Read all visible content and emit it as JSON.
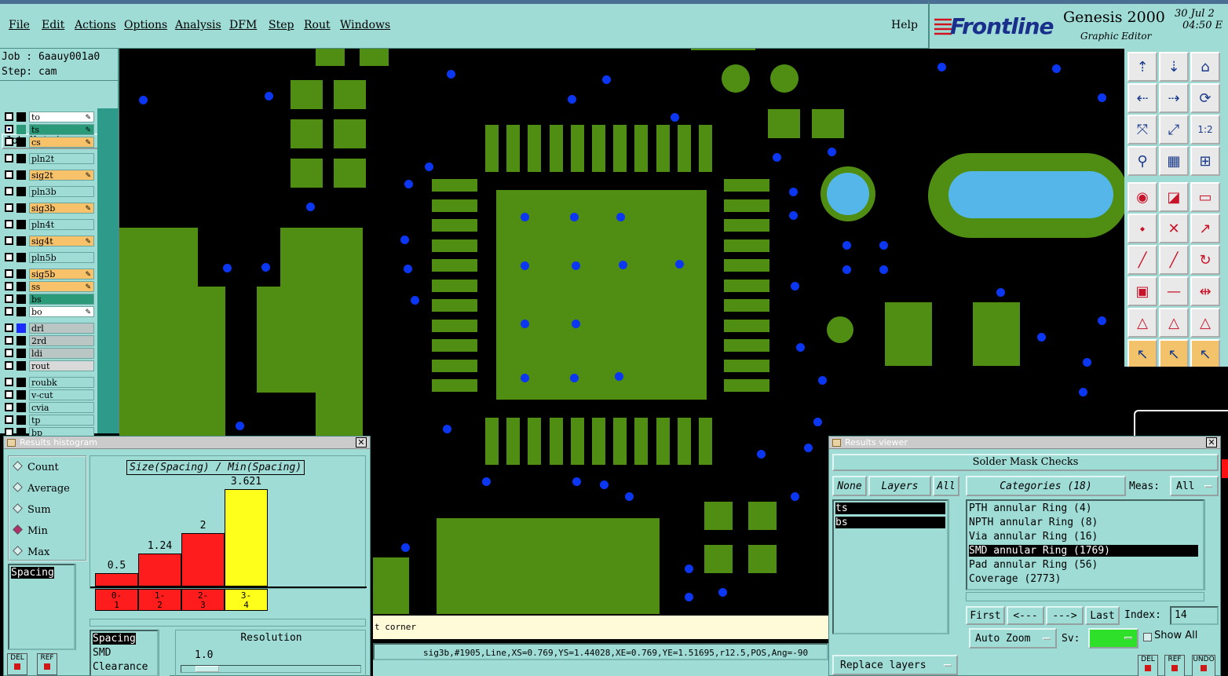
{
  "menu": {
    "items": [
      "File",
      "Edit",
      "Actions",
      "Options",
      "Analysis",
      "DFM",
      "Step",
      "Rout",
      "Windows"
    ],
    "help": "Help"
  },
  "brand": {
    "logo": "Frontline",
    "product": "Genesis 2000",
    "subtitle": "Graphic Editor",
    "date": "30 Jul 2",
    "time": "04:50 E"
  },
  "job": {
    "job_label": "Job : 6aauy001a0",
    "step_label": "Step: cam",
    "matrix_button": "Job Matrix ..."
  },
  "layers": [
    {
      "name": "to",
      "bg": "#ffffff",
      "sq": "#000000",
      "pen": true,
      "checked": false
    },
    {
      "name": "ts",
      "bg": "#2b9a78",
      "sq": "#2b9a78",
      "pen": true,
      "checked": true
    },
    {
      "name": "cs",
      "bg": "#f7c26a",
      "sq": "#000000",
      "pen": true,
      "checked": false
    },
    {
      "name": "pln2t",
      "bg": "#9fdcd6",
      "sq": "#000000",
      "pen": false,
      "checked": false
    },
    {
      "name": "sig2t",
      "bg": "#f7c26a",
      "sq": "#000000",
      "pen": true,
      "checked": false
    },
    {
      "name": "pln3b",
      "bg": "#9fdcd6",
      "sq": "#000000",
      "pen": false,
      "checked": false
    },
    {
      "name": "sig3b",
      "bg": "#f7c26a",
      "sq": "#000000",
      "pen": true,
      "checked": false
    },
    {
      "name": "pln4t",
      "bg": "#9fdcd6",
      "sq": "#000000",
      "pen": false,
      "checked": false
    },
    {
      "name": "sig4t",
      "bg": "#f7c26a",
      "sq": "#000000",
      "pen": true,
      "checked": false
    },
    {
      "name": "pln5b",
      "bg": "#9fdcd6",
      "sq": "#000000",
      "pen": false,
      "checked": false
    },
    {
      "name": "sig5b",
      "bg": "#f7c26a",
      "sq": "#000000",
      "pen": true,
      "checked": false
    },
    {
      "name": "ss",
      "bg": "#f7c26a",
      "sq": "#000000",
      "pen": true,
      "checked": false
    },
    {
      "name": "bs",
      "bg": "#2b9a78",
      "sq": "#000000",
      "pen": false,
      "checked": false
    },
    {
      "name": "bo",
      "bg": "#ffffff",
      "sq": "#000000",
      "pen": true,
      "checked": false
    },
    {
      "name": "drl",
      "bg": "#b9c6c4",
      "sq": "#1b2cff",
      "pen": false,
      "checked": false
    },
    {
      "name": "2rd",
      "bg": "#b9c6c4",
      "sq": "#000000",
      "pen": false,
      "checked": false
    },
    {
      "name": "ldi",
      "bg": "#b9c6c4",
      "sq": "#000000",
      "pen": false,
      "checked": false
    },
    {
      "name": "rout",
      "bg": "#d9d9d9",
      "sq": "#000000",
      "pen": false,
      "checked": false
    },
    {
      "name": "roubk",
      "bg": "#9fdcd6",
      "sq": "#000000",
      "pen": false,
      "checked": false
    },
    {
      "name": "v-cut",
      "bg": "#9fdcd6",
      "sq": "#000000",
      "pen": false,
      "checked": false
    },
    {
      "name": "cvia",
      "bg": "#9fdcd6",
      "sq": "#000000",
      "pen": false,
      "checked": false
    },
    {
      "name": "tp",
      "bg": "#9fdcd6",
      "sq": "#000000",
      "pen": false,
      "checked": false
    },
    {
      "name": "bp",
      "bg": "#9fdcd6",
      "sq": "#000000",
      "pen": false,
      "checked": false
    }
  ],
  "histogram": {
    "title": "Results histogram",
    "modes": [
      {
        "label": "Count",
        "on": false
      },
      {
        "label": "Average",
        "on": false
      },
      {
        "label": "Sum",
        "on": false
      },
      {
        "label": "Min",
        "on": true
      },
      {
        "label": "Max",
        "on": false
      }
    ],
    "attribute_selected": "Spacing",
    "chart_title": "Size(Spacing) / Min(Spacing)",
    "bars": [
      {
        "value": 0.5,
        "label": "0.5",
        "bin": "0-\n1",
        "color": "#ff1c1c"
      },
      {
        "value": 1.24,
        "label": "1.24",
        "bin": "1-\n2",
        "color": "#ff1c1c"
      },
      {
        "value": 2,
        "label": "2",
        "bin": "2-\n3",
        "color": "#ff1c1c"
      },
      {
        "value": 3.621,
        "label": "3.621",
        "bin": "3-\n4",
        "color": "#ffff1c"
      }
    ],
    "attributes": [
      "Spacing",
      "SMD",
      "Clearance"
    ],
    "resolution_label": "Resolution",
    "resolution_value": "1.0",
    "del": "DEL",
    "ref": "REF"
  },
  "chart_data": {
    "type": "bar",
    "title": "Size(Spacing) / Min(Spacing)",
    "categories": [
      "0-1",
      "1-2",
      "2-3",
      "3-4"
    ],
    "values": [
      0.5,
      1.24,
      2,
      3.621
    ],
    "ylim": [
      0,
      3.621
    ]
  },
  "viewer": {
    "title": "Results viewer",
    "header": "Solder Mask Checks",
    "none_btn": "None",
    "layers_btn": "Layers",
    "all_btn": "All",
    "categories_btn": "Categories (18)",
    "meas_label": "Meas:",
    "meas_value": "All",
    "layer_list": [
      "ts",
      "bs"
    ],
    "categories": [
      {
        "text": "PTH annular Ring (4)",
        "sel": false
      },
      {
        "text": "NPTH annular Ring (8)",
        "sel": false
      },
      {
        "text": "Via annular Ring (16)",
        "sel": false
      },
      {
        "text": "SMD annular Ring (1769)",
        "sel": true
      },
      {
        "text": "Pad annular Ring (56)",
        "sel": false
      },
      {
        "text": "Coverage (2773)",
        "sel": false
      }
    ],
    "first": "First",
    "prev": "<---",
    "next": "--->",
    "last": "Last",
    "index_label": "Index:",
    "index_value": "14",
    "auto_zoom": "Auto Zoom",
    "sv_label": "Sv:",
    "show_all": "Show All",
    "replace_layers": "Replace layers",
    "del": "DEL",
    "ref": "REF",
    "undo": "UNDO"
  },
  "status": {
    "corner": "t corner",
    "line": "sig3b,#1905,Line,XS=0.769,YS=1.44028,XE=0.769,YE=1.51695,r12.5,POS,Ang=-90"
  },
  "toolbar": {
    "zoom_half": "1:2"
  }
}
